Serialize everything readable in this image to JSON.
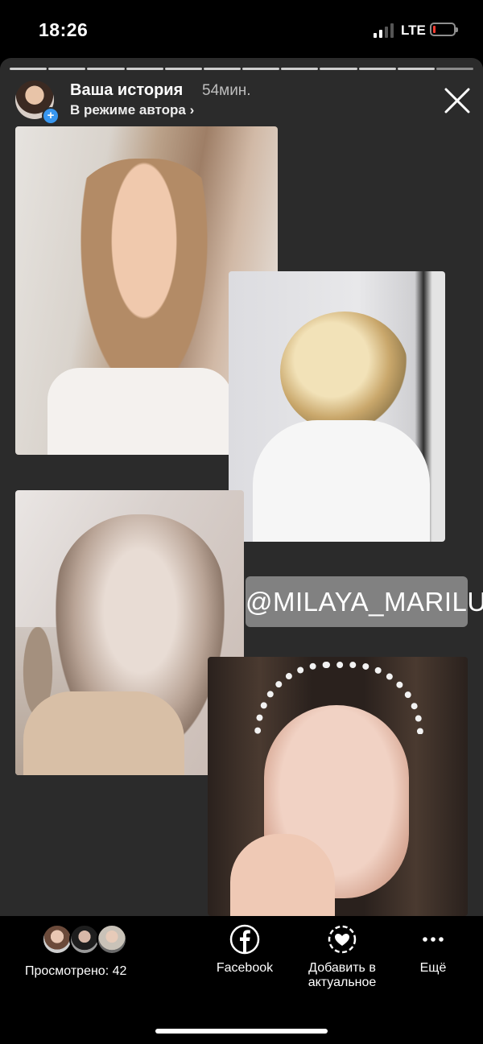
{
  "status_bar": {
    "time": "18:26",
    "network": "LTE",
    "battery_level": 0.1,
    "battery_color": "#ff3b30"
  },
  "story": {
    "segments_total": 12,
    "segments_done": 11,
    "title": "Ваша история",
    "time_ago": "54мин.",
    "subtitle": "В режиме автора ›",
    "close_icon": "close-icon",
    "sticker_text": "@MILAYA_MARILU",
    "background_color": "#2b2b2b"
  },
  "bottom_bar": {
    "viewers_label": "Просмотрено: 42",
    "facebook_label": "Facebook",
    "highlight_label_line1": "Добавить в",
    "highlight_label_line2": "актуальное",
    "more_label": "Ещё"
  }
}
